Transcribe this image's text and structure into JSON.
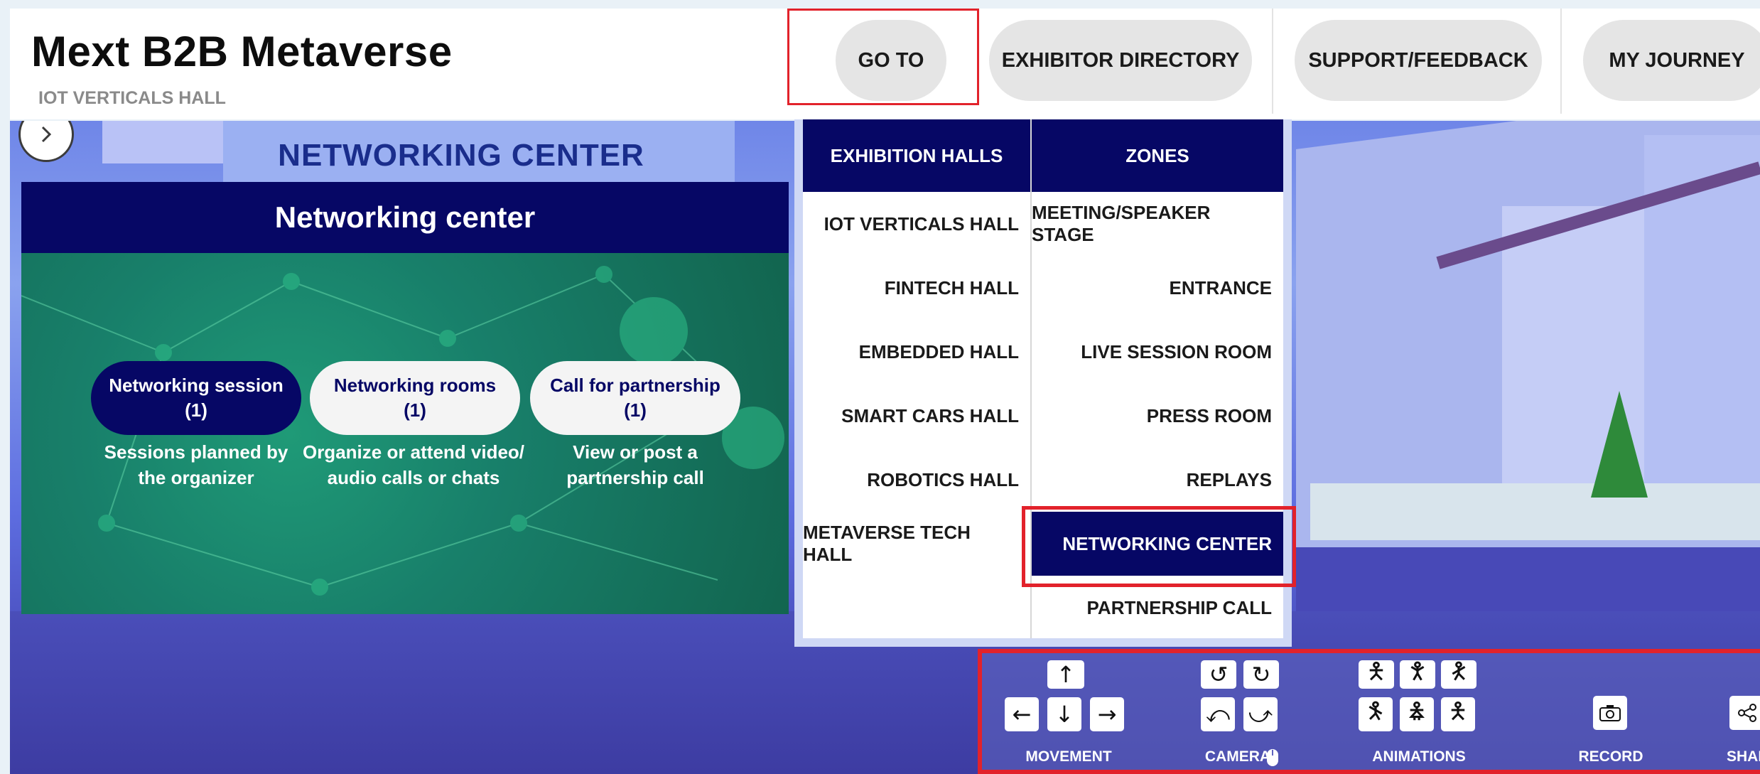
{
  "app": {
    "title": "Mext B2B Metaverse",
    "subtitle": "IOT VERTICALS HALL"
  },
  "nav": {
    "goto": "GO TO",
    "exhibitor_directory": "EXHIBITOR DIRECTORY",
    "support": "SUPPORT/FEEDBACK",
    "journey": "MY JOURNEY"
  },
  "scene": {
    "sign": "NETWORKING CENTER"
  },
  "networking_panel": {
    "title": "Networking center",
    "options": [
      {
        "label": "Networking session",
        "count": "(1)",
        "desc1": "Sessions planned by",
        "desc2": "the organizer"
      },
      {
        "label": "Networking rooms",
        "count": "(1)",
        "desc1": "Organize or attend video/",
        "desc2": "audio calls or chats"
      },
      {
        "label": "Call for partnership",
        "count": "(1)",
        "desc1": "View or post a",
        "desc2": "partnership call"
      }
    ]
  },
  "goto_menu": {
    "halls_header": "EXHIBITION HALLS",
    "zones_header": "ZONES",
    "halls": [
      "IOT VERTICALS HALL",
      "FINTECH HALL",
      "EMBEDDED HALL",
      "SMART CARS HALL",
      "ROBOTICS HALL",
      "METAVERSE TECH HALL"
    ],
    "zones": [
      "MEETING/SPEAKER STAGE",
      "ENTRANCE",
      "LIVE SESSION ROOM",
      "PRESS ROOM",
      "REPLAYS",
      "NETWORKING CENTER",
      "PARTNERSHIP CALL"
    ],
    "active_zone": "NETWORKING CENTER"
  },
  "controls": {
    "movement": "MOVEMENT",
    "camera": "CAMERA",
    "animations": "ANIMATIONS",
    "record": "RECORD",
    "share": "SHAR"
  },
  "colors": {
    "navy": "#060765",
    "highlight_red": "#e2222b",
    "pill_grey": "#e5e5e5"
  }
}
